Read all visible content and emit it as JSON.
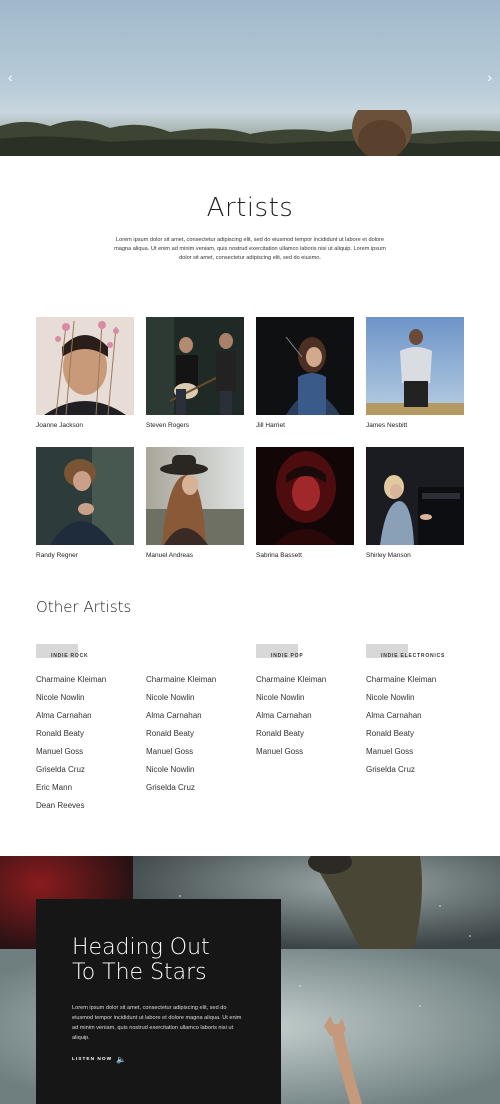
{
  "hero": {
    "prev_icon": "chevron-left-icon",
    "next_icon": "chevron-right-icon",
    "prev": "‹",
    "next": "›"
  },
  "artists_section": {
    "title": "Artists",
    "intro": "Lorem ipsum dolor sit amet, consectetur adipiscing elit, sed do eiusmod tempor incididunt ut labore et dolore magna aliqua. Ut enim ad minim veniam, quis nostrud exercitation ullamco laboris nisi ut aliquip. Lorem ipsum dolor sit amet, consectetur adipiscing elit, sed do eiusmo."
  },
  "artists": [
    {
      "name": "Joanne Jackson"
    },
    {
      "name": "Steven Rogers"
    },
    {
      "name": "Jill Harriet"
    },
    {
      "name": "James Nesbitt"
    },
    {
      "name": "Randy Regner"
    },
    {
      "name": "Manuel Andreas"
    },
    {
      "name": "Sabrina Bassett"
    },
    {
      "name": "Shirley Manson"
    }
  ],
  "other_artists": {
    "title": "Other Artists",
    "columns": [
      {
        "tag": "INDIE ROCK",
        "names": [
          "Charmaine Kleiman",
          "Nicole Nowlin",
          "Alma Carnahan",
          "Ronald Beaty",
          "Manuel Goss",
          "Griselda Cruz",
          "Eric Mann",
          "Dean Reeves"
        ]
      },
      {
        "tag": "",
        "names": [
          "Charmaine Kleiman",
          "Nicole Nowlin",
          "Alma Carnahan",
          "Ronald Beaty",
          "Manuel Goss",
          "Nicole Nowlin",
          "Griselda Cruz"
        ]
      },
      {
        "tag": "INDIE POP",
        "names": [
          "Charmaine Kleiman",
          "Nicole Nowlin",
          "Alma Carnahan",
          "Ronald Beaty",
          "Manuel Goss"
        ]
      },
      {
        "tag": "INDIE ELECTRONICS",
        "names": [
          "Charmaine Kleiman",
          "Nicole Nowlin",
          "Alma Carnahan",
          "Ronald Beaty",
          "Manuel Goss",
          "Griselda Cruz"
        ]
      }
    ]
  },
  "feature": {
    "heading": "Heading Out\nTo The Stars",
    "body": "Lorem ipsum dolor sit amet, consectetur adipiscing elit, sed do eiusmod tempor incididunt ut labore et dolore magna aliqua. Ut enim ad minim veniam, quis nostrud exercitation ullamco laboris nisi ut aliquip.",
    "listen_label": "LISTEN NOW",
    "listen_icon": "speaker-icon"
  }
}
